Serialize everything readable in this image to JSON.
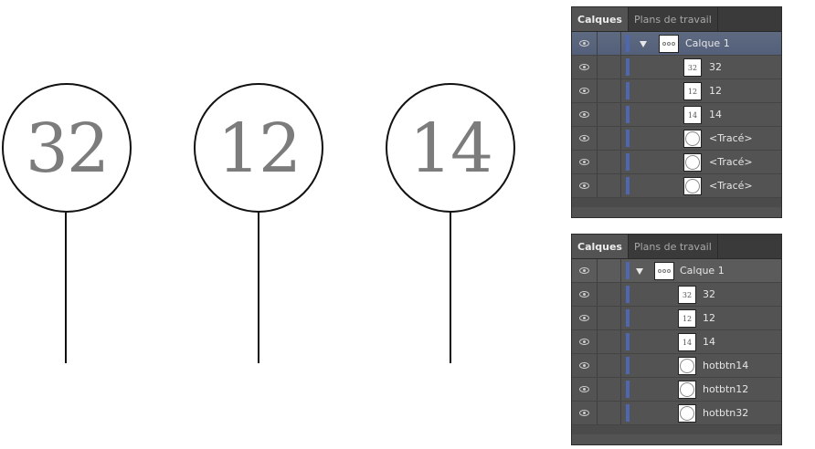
{
  "canvas": {
    "pins": [
      {
        "number": "32"
      },
      {
        "number": "12"
      },
      {
        "number": "14"
      }
    ]
  },
  "panels": [
    {
      "tabs": [
        {
          "label": "Calques",
          "active": true
        },
        {
          "label": "Plans de travail",
          "active": false
        }
      ],
      "group": {
        "label": "Calque 1"
      },
      "layers": [
        {
          "label": "32",
          "thumb": "32"
        },
        {
          "label": "12",
          "thumb": "12"
        },
        {
          "label": "14",
          "thumb": "14"
        },
        {
          "label": "<Tracé>",
          "thumb": "circle"
        },
        {
          "label": "<Tracé>",
          "thumb": "circle"
        },
        {
          "label": "<Tracé>",
          "thumb": "circle"
        }
      ]
    },
    {
      "tabs": [
        {
          "label": "Calques",
          "active": true
        },
        {
          "label": "Plans de travail",
          "active": false
        }
      ],
      "group": {
        "label": "Calque 1"
      },
      "layers": [
        {
          "label": "32",
          "thumb": "32"
        },
        {
          "label": "12",
          "thumb": "12"
        },
        {
          "label": "14",
          "thumb": "14"
        },
        {
          "label": "hotbtn14",
          "thumb": "circle"
        },
        {
          "label": "hotbtn12",
          "thumb": "circle"
        },
        {
          "label": "hotbtn32",
          "thumb": "circle"
        }
      ]
    }
  ],
  "colors": {
    "panel_bg": "#535353",
    "layer_color_bar": "#4f67b0",
    "pin_number": "#7c7c7c"
  }
}
